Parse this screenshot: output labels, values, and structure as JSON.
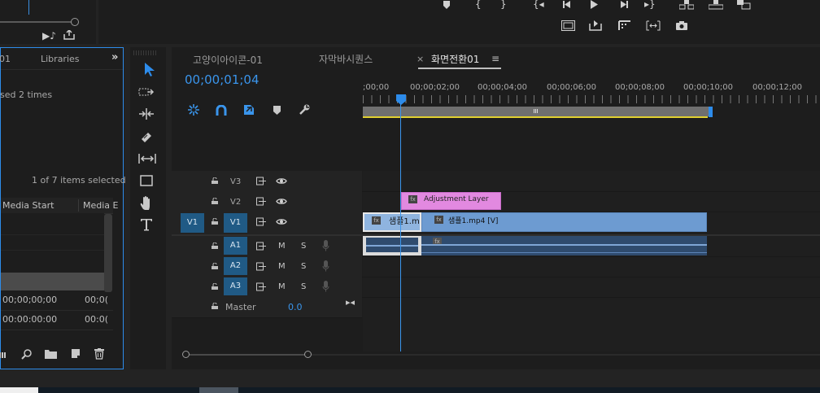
{
  "program_monitor": {
    "controls": [
      "marker-icon",
      "mark-in-icon",
      "mark-out-icon",
      "go-to-in-icon",
      "step-back-icon",
      "play-icon",
      "step-forward-icon",
      "go-to-out-icon",
      "lift-icon",
      "extract-icon",
      "export-frame-icon"
    ]
  },
  "project_panel": {
    "tab_partial": "01",
    "tab_libraries": "Libraries",
    "overflow": "»",
    "used_text": "sed 2 times",
    "selection_info": "1 of 7 items selected",
    "col_media_start": "Media Start",
    "col_media_end": "Media E",
    "rows": [
      {
        "start": "00;00;00;00",
        "end": "00;0("
      },
      {
        "start": "00:00:00:00",
        "end": "00:0("
      }
    ]
  },
  "tools": [
    "selection-tool",
    "track-select-tool",
    "ripple-edit-tool",
    "razor-tool",
    "slip-tool",
    "pen-tool",
    "hand-tool",
    "type-tool"
  ],
  "timeline": {
    "tabs": [
      {
        "label": "고양이아이콘-01",
        "active": false
      },
      {
        "label": "자막바시퀀스",
        "active": false
      },
      {
        "label": "화면전환01",
        "active": true
      }
    ],
    "close_symbol": "×",
    "menu_symbol": "≡",
    "timecode": "00;00;01;04",
    "ruler": [
      ";00;00",
      "00;00;02;00",
      "00;00;04;00",
      "00;00;06;00",
      "00;00;08;00",
      "00;00;10;00",
      "00;00;12;00"
    ],
    "video_tracks": [
      {
        "name": "V3",
        "source": ""
      },
      {
        "name": "V2",
        "source": ""
      },
      {
        "name": "V1",
        "source": "V1"
      }
    ],
    "audio_tracks": [
      {
        "name": "A1",
        "m": "M",
        "s": "S"
      },
      {
        "name": "A2",
        "m": "M",
        "s": "S"
      },
      {
        "name": "A3",
        "m": "M",
        "s": "S"
      }
    ],
    "master_label": "Master",
    "master_value": "0.0",
    "clips": {
      "adjustment": "Adjustment Layer",
      "video1": "샘플1.m",
      "video2": "샘플1.mp4 [V]",
      "fx": "fx"
    },
    "colors": {
      "accent": "#2d8ceb",
      "video_clip": "#6d9bd1",
      "adjustment_clip": "#e289e0",
      "audio_clip": "#2f4b6e",
      "work_area": "#e0d030",
      "track_target": "#205a85"
    }
  }
}
